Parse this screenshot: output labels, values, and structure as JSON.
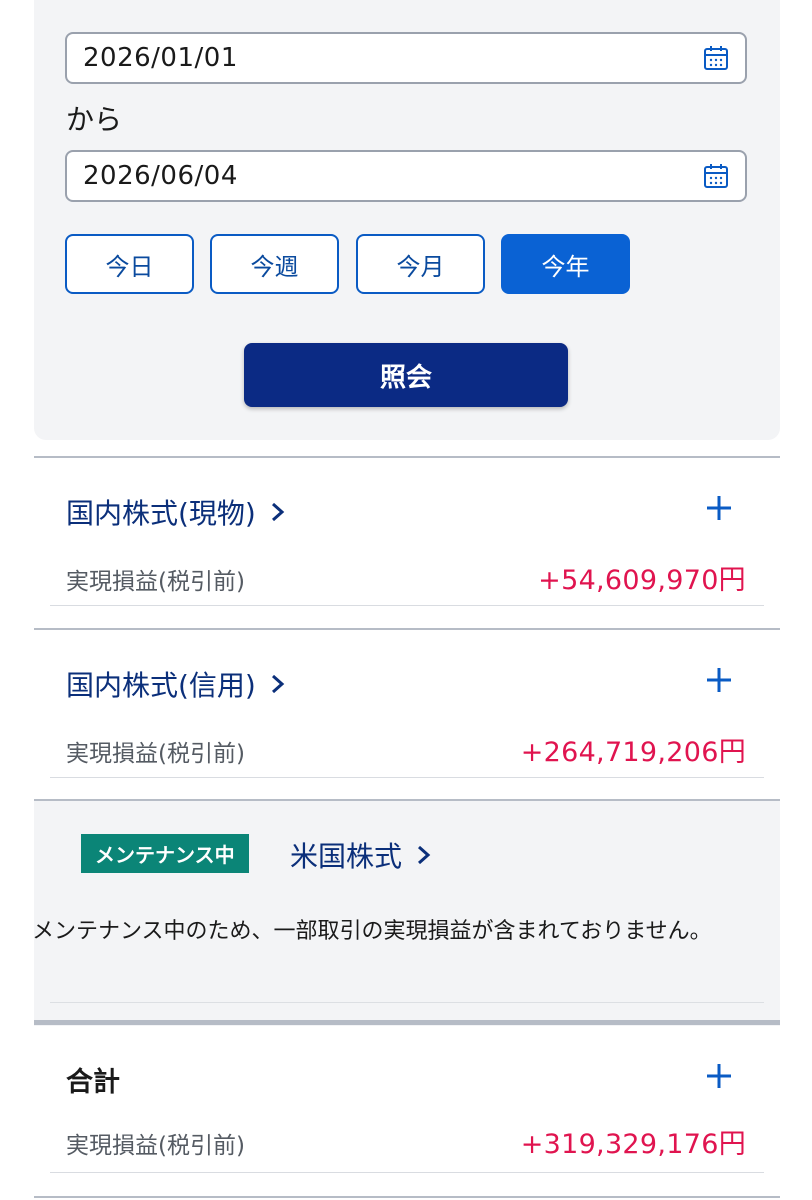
{
  "filter": {
    "start_date": "2026/01/01",
    "from_label": "から",
    "end_date": "2026/06/04",
    "presets": [
      {
        "label": "今日",
        "active": false
      },
      {
        "label": "今週",
        "active": false
      },
      {
        "label": "今月",
        "active": false
      },
      {
        "label": "今年",
        "active": true
      }
    ],
    "submit_label": "照会"
  },
  "sections": [
    {
      "title": "国内株式(現物)",
      "pl_label": "実現損益(税引前)",
      "pl_value": "+54,609,970円"
    },
    {
      "title": "国内株式(信用)",
      "pl_label": "実現損益(税引前)",
      "pl_value": "+264,719,206円"
    }
  ],
  "maintenance": {
    "badge": "メンテナンス中",
    "title": "米国株式",
    "note": "メンテナンス中のため、一部取引の実現損益が含まれておりません。"
  },
  "total": {
    "title": "合計",
    "pl_label": "実現損益(税引前)",
    "pl_value": "+319,329,176円"
  },
  "colors": {
    "primary_blue": "#0a62d4",
    "navy": "#0b2a84",
    "gain_red": "#e0144f",
    "maintenance_teal": "#0b8577"
  }
}
